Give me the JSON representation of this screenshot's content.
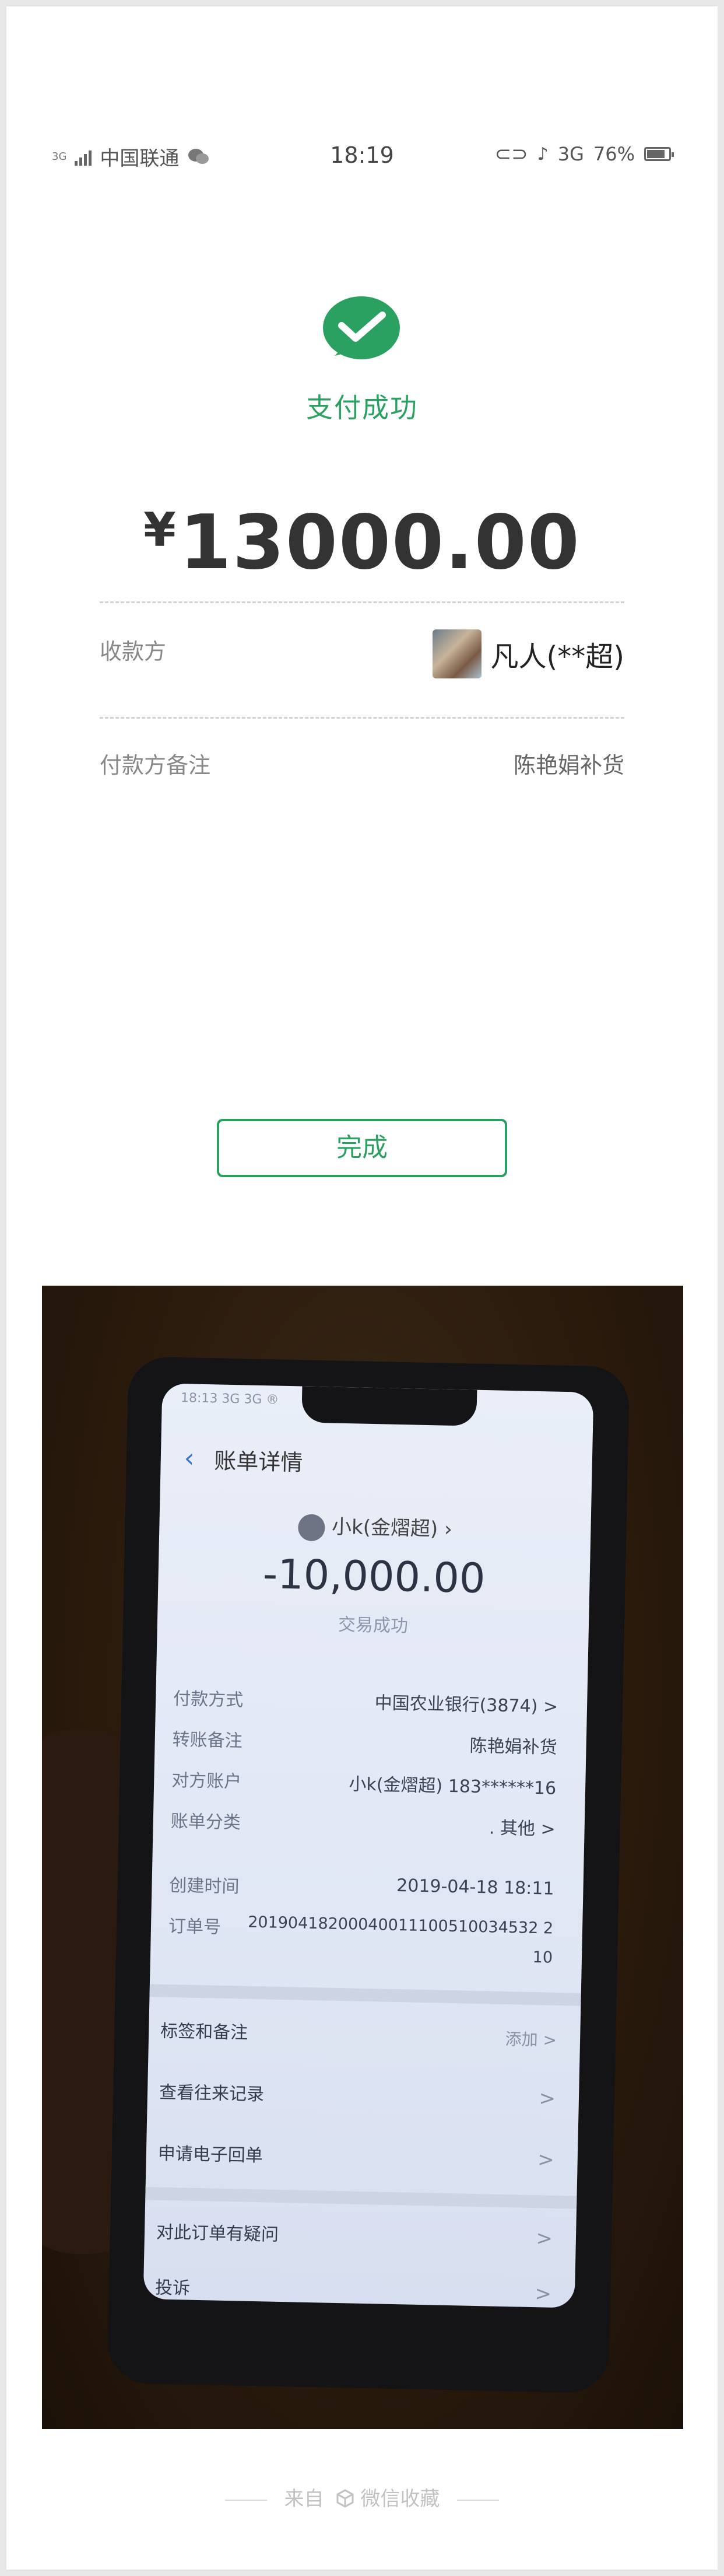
{
  "status_bar": {
    "network_badge": "3G",
    "carrier": "中国联通",
    "time": "18:19",
    "network": "3G",
    "battery": "76%"
  },
  "payment": {
    "status": "支付成功",
    "currency": "¥",
    "amount": "13000.00",
    "payee_label": "收款方",
    "payee_name": "凡人(**超)",
    "remark_label": "付款方备注",
    "remark_value": "陈艳娟补货",
    "done_button": "完成"
  },
  "photo_screen": {
    "time": "18:13 3G 3G ®",
    "back_icon": "‹",
    "title": "账单详情",
    "user": "小k(金熠超)",
    "amount": "-10,000.00",
    "status": "交易成功",
    "rows": [
      {
        "label": "付款方式",
        "value": "中国农业银行(3874) >"
      },
      {
        "label": "转账备注",
        "value": "陈艳娟补货"
      },
      {
        "label": "对方账户",
        "value": "小k(金熠超) 183******16"
      },
      {
        "label": "账单分类",
        "value": ". 其他 >"
      }
    ],
    "created_label": "创建时间",
    "created_value": "2019-04-18 18:11",
    "order_label": "订单号",
    "order_value_1": "20190418200040011100510034532 2",
    "order_value_2": "10",
    "menu": [
      {
        "label": "标签和备注",
        "value": "添加 >"
      },
      {
        "label": "查看往来记录",
        "value": ">"
      },
      {
        "label": "申请电子回单",
        "value": ">"
      },
      {
        "label": "对此订单有疑问",
        "value": ">"
      },
      {
        "label": "投诉",
        "value": ">"
      }
    ]
  },
  "footer": {
    "from_label": "来自",
    "source": "微信收藏"
  },
  "colors": {
    "wechat_green": "#2aa160",
    "text_dark": "#333333",
    "text_muted": "#888888"
  }
}
